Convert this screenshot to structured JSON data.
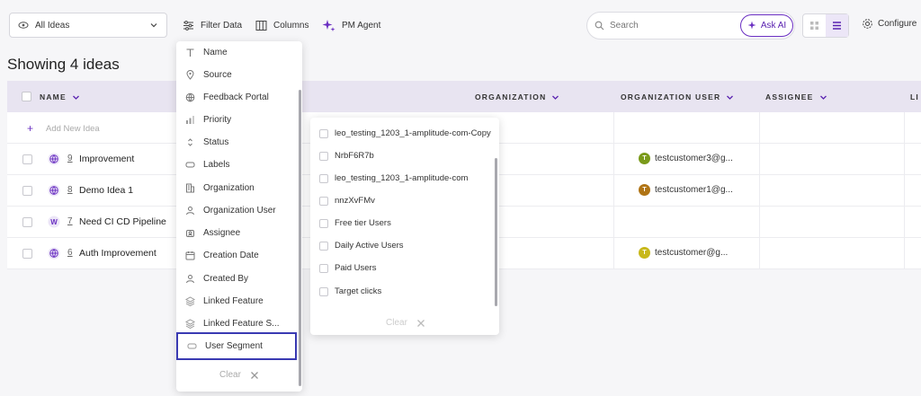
{
  "toolbar": {
    "view_select": "All Ideas",
    "filter_data": "Filter Data",
    "columns": "Columns",
    "pm_agent": "PM Agent",
    "search_placeholder": "Search",
    "ask_ai": "Ask AI",
    "configure": "Configure"
  },
  "heading": "Showing 4 ideas",
  "table": {
    "headers": {
      "name": "NAME",
      "organization": "ORGANIZATION",
      "organization_user": "ORGANIZATION USER",
      "assignee": "ASSIGNEE",
      "partial": "LI"
    },
    "add_new_idea": "Add New Idea",
    "rows": [
      {
        "id": "9",
        "title": "Improvement",
        "icon": "globe-icon",
        "user": "testcustomer3@g...",
        "avatar": "T",
        "avatar_color": "#7a9a1a"
      },
      {
        "id": "8",
        "title": "Demo Idea 1",
        "icon": "globe-icon",
        "user": "testcustomer1@g...",
        "avatar": "T",
        "avatar_color": "#b07415"
      },
      {
        "id": "7",
        "title": "Need CI CD Pipeline",
        "icon": "w-letter-icon",
        "user": "",
        "avatar": "",
        "avatar_color": ""
      },
      {
        "id": "6",
        "title": "Auth Improvement",
        "icon": "globe-icon",
        "user": "testcustomer@g...",
        "avatar": "T",
        "avatar_color": "#c8b81a"
      }
    ]
  },
  "field_dropdown": {
    "items": [
      {
        "label": "Name",
        "icon": "text-icon"
      },
      {
        "label": "Source",
        "icon": "location-pin-icon"
      },
      {
        "label": "Feedback Portal",
        "icon": "globe-icon"
      },
      {
        "label": "Priority",
        "icon": "bar-chart-icon"
      },
      {
        "label": "Status",
        "icon": "sort-arrows-icon"
      },
      {
        "label": "Labels",
        "icon": "tag-icon"
      },
      {
        "label": "Organization",
        "icon": "building-icon"
      },
      {
        "label": "Organization User",
        "icon": "user-icon"
      },
      {
        "label": "Assignee",
        "icon": "assignee-icon"
      },
      {
        "label": "Creation Date",
        "icon": "calendar-icon"
      },
      {
        "label": "Created By",
        "icon": "user-icon"
      },
      {
        "label": "Linked Feature",
        "icon": "layers-icon"
      },
      {
        "label": "Linked Feature S...",
        "icon": "layers-icon"
      },
      {
        "label": "User Segment",
        "icon": "tag-icon"
      }
    ],
    "clear": "Clear"
  },
  "segment_dropdown": {
    "items": [
      "leo_testing_1203_1-amplitude-com-Copy",
      "NrbF6R7b",
      "leo_testing_1203_1-amplitude-com",
      "nnzXvFMv",
      "Free tier Users",
      "Daily Active Users",
      "Paid Users",
      "Target clicks"
    ],
    "clear": "Clear"
  },
  "colors": {
    "accent": "#6a2fc2",
    "header_bg": "#e8e4f1",
    "selected_outline": "#3a3ab2"
  }
}
